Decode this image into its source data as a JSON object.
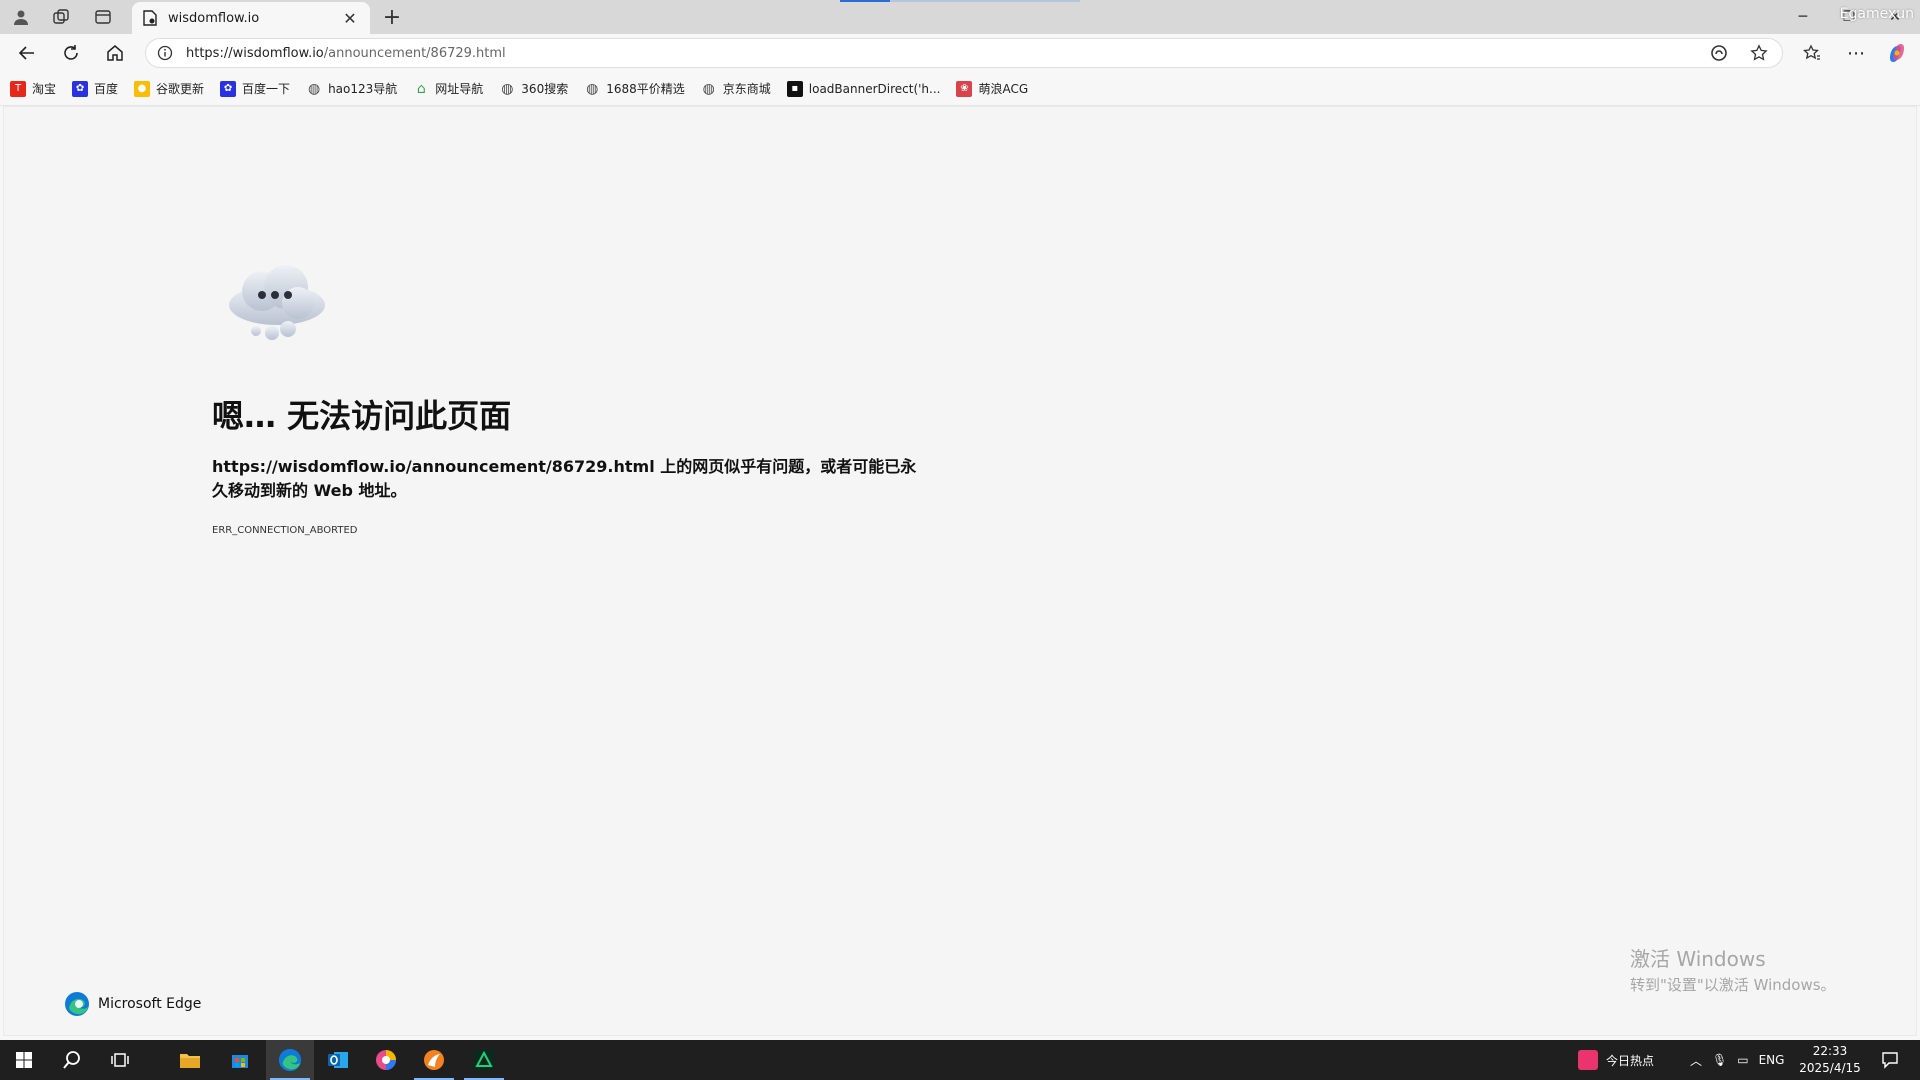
{
  "browser": {
    "tab_title": "wisdomflow.io",
    "url_host": "https://wisdomflow.io",
    "url_path": "/announcement/86729.html",
    "overlay_label": "Egamexun"
  },
  "bookmarks": [
    {
      "label": "淘宝",
      "icon": "taobao-icon",
      "color": "#e8271b",
      "glyph": "T"
    },
    {
      "label": "百度",
      "icon": "baidu-icon",
      "color": "#2932e1",
      "glyph": "✿"
    },
    {
      "label": "谷歌更新",
      "icon": "chrome-icon",
      "color": "#fbbc05",
      "glyph": "●"
    },
    {
      "label": "百度一下",
      "icon": "baidu-icon",
      "color": "#2932e1",
      "glyph": "✿"
    },
    {
      "label": "hao123导航",
      "icon": "globe-icon",
      "color": "#444444",
      "glyph": "◍"
    },
    {
      "label": "网址导航",
      "icon": "home-icon",
      "color": "#3ba44b",
      "glyph": "⌂"
    },
    {
      "label": "360搜索",
      "icon": "globe-icon",
      "color": "#444444",
      "glyph": "◍"
    },
    {
      "label": "1688平价精选",
      "icon": "globe-icon",
      "color": "#444444",
      "glyph": "◍"
    },
    {
      "label": "京东商城",
      "icon": "globe-icon",
      "color": "#444444",
      "glyph": "◍"
    },
    {
      "label": "loadBannerDirect('h...",
      "icon": "site-icon",
      "color": "#111111",
      "glyph": "▪"
    },
    {
      "label": "萌浪ACG",
      "icon": "acg-icon",
      "color": "#d9434b",
      "glyph": "❀"
    }
  ],
  "error": {
    "title": "嗯… 无法访问此页面",
    "url_bold": "https://wisdomflow.io/announcement/86729.html",
    "message": " 上的网页似乎有问题，或者可能已永久移动到新的 Web 地址。",
    "code": "ERR_CONNECTION_ABORTED"
  },
  "brand": "Microsoft Edge",
  "watermark": {
    "line1": "激活 Windows",
    "line2": "转到\"设置\"以激活 Windows。"
  },
  "taskbar": {
    "news_label": "今日热点",
    "lang": "ENG",
    "time": "22:33",
    "date": "2025/4/15"
  }
}
